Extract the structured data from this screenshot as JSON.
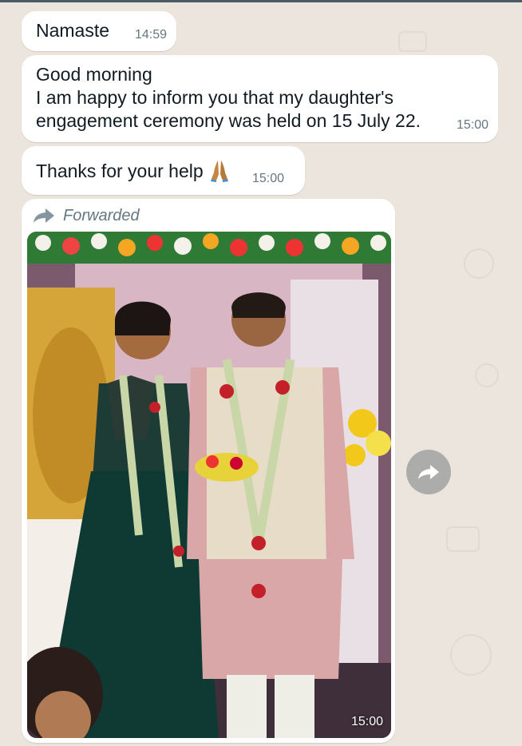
{
  "messages": [
    {
      "text": "Namaste",
      "time": "14:59"
    },
    {
      "text": "Good morning\nI am happy to inform you that my daughter's\nengagement ceremony was held on 15 July 22.",
      "time": "15:00"
    },
    {
      "text": "Thanks for your help",
      "emoji": "folded-hands",
      "time": "15:00"
    }
  ],
  "forwarded": {
    "label": "Forwarded",
    "image": "engagement-photo",
    "time": "15:00"
  },
  "icons": {
    "forwarded": "forward-arrow-icon",
    "share": "share-forward-icon"
  },
  "colors": {
    "chat_background": "#ece5dd",
    "bubble": "#ffffff",
    "meta_text": "#667781"
  }
}
